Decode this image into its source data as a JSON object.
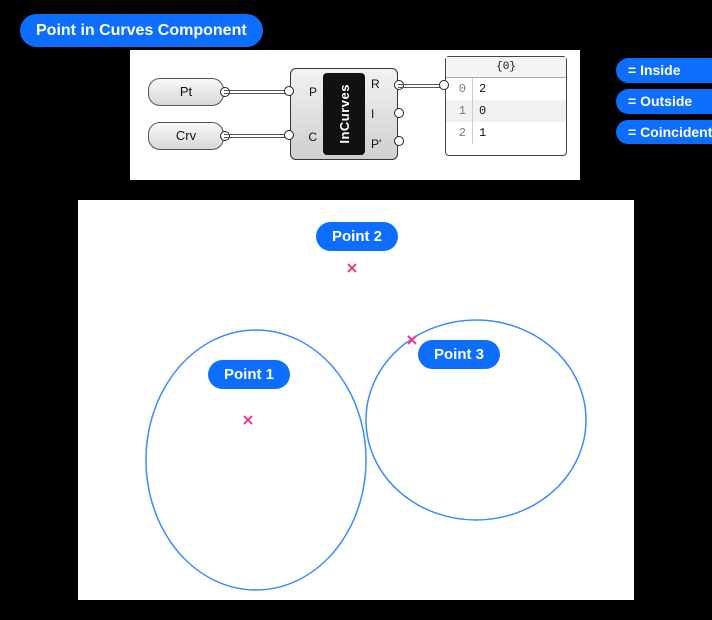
{
  "title": "Point in Curves Component",
  "legend": {
    "inside": "= Inside",
    "outside": "= Outside",
    "coincident": "= Coincident"
  },
  "component": {
    "name": "InCurves",
    "inputs": {
      "pt": "Pt",
      "crv": "Crv",
      "p": "P",
      "c": "C"
    },
    "outputs": {
      "r": "R",
      "i": "I",
      "pprime": "P'"
    }
  },
  "panel": {
    "header": "{0}",
    "rows": [
      {
        "index": "0",
        "value": "2"
      },
      {
        "index": "1",
        "value": "0"
      },
      {
        "index": "2",
        "value": "1"
      }
    ]
  },
  "points": {
    "p1": "Point 1",
    "p2": "Point 2",
    "p3": "Point 3"
  }
}
